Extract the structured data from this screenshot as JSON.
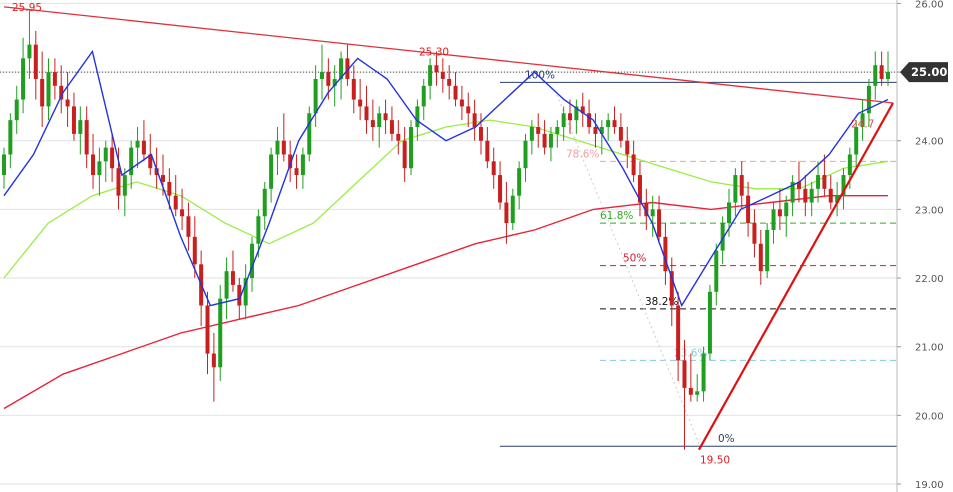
{
  "chart_data": {
    "type": "candlestick",
    "y_axis": {
      "ticks": [
        26.0,
        25.0,
        24.0,
        23.0,
        22.0,
        21.0,
        20.0,
        19.0
      ],
      "tick_labels": [
        "26.00",
        "25.00",
        "24.00",
        "23.00",
        "22.00",
        "21.00",
        "20.00",
        "19.00"
      ],
      "ylim": [
        19.0,
        26.05
      ],
      "position": "right"
    },
    "grid": true,
    "colors": {
      "up": "#1f9e1f",
      "down": "#c81f1f",
      "ma_fast": "#2233dd",
      "ma_mid": "#99ee44",
      "ma_slow": "#e8223a",
      "trendline": "#e0303a",
      "support_line": "#dd1111",
      "price_tag": "#333333"
    },
    "current_price": {
      "value": 25.0,
      "label": "25.00"
    },
    "annotations": {
      "high_label": {
        "text": "25.95",
        "price": 25.95
      },
      "swing_high_label": {
        "text": "25.30",
        "price": 25.3
      },
      "swing_low_label": {
        "text": "19.50",
        "price": 19.5
      },
      "fib_level_24_7": {
        "text": "24.7",
        "price": 24.25
      }
    },
    "fibonacci": {
      "high": 24.85,
      "low": 19.55,
      "levels": [
        {
          "label": "100%",
          "price": 24.85,
          "color": "#2a3f6e"
        },
        {
          "label": "78.6%",
          "price": 23.7,
          "color": "#f0a0a0"
        },
        {
          "label": "61.8%",
          "price": 22.8,
          "color": "#33aa22"
        },
        {
          "label": "50%",
          "price": 22.18,
          "color": "#cc2233"
        },
        {
          "label": "38.2%",
          "price": 21.55,
          "color": "#111111"
        },
        {
          "label": "23.6%",
          "price": 20.8,
          "color": "#88ccdd"
        },
        {
          "label": "0%",
          "price": 19.55,
          "color": "#2a3f6e"
        }
      ]
    },
    "candles": [
      [
        23.5,
        23.9,
        23.3,
        23.8
      ],
      [
        23.8,
        24.4,
        23.6,
        24.3
      ],
      [
        24.3,
        24.8,
        24.1,
        24.6
      ],
      [
        24.6,
        25.5,
        24.4,
        25.2
      ],
      [
        25.2,
        25.9,
        24.9,
        25.4
      ],
      [
        25.4,
        25.6,
        24.6,
        24.9
      ],
      [
        24.9,
        25.3,
        24.2,
        24.5
      ],
      [
        24.5,
        25.2,
        24.3,
        25.0
      ],
      [
        25.0,
        25.2,
        24.6,
        24.8
      ],
      [
        24.8,
        25.1,
        24.4,
        24.6
      ],
      [
        24.6,
        25.0,
        24.2,
        24.5
      ],
      [
        24.5,
        24.7,
        24.0,
        24.1
      ],
      [
        24.1,
        24.5,
        23.8,
        24.3
      ],
      [
        24.3,
        24.5,
        23.6,
        23.8
      ],
      [
        23.8,
        24.1,
        23.3,
        23.5
      ],
      [
        23.5,
        23.9,
        23.2,
        23.7
      ],
      [
        23.7,
        24.0,
        23.4,
        23.9
      ],
      [
        23.9,
        24.1,
        23.4,
        23.6
      ],
      [
        23.6,
        23.9,
        23.0,
        23.2
      ],
      [
        23.2,
        23.6,
        22.9,
        23.5
      ],
      [
        23.5,
        24.0,
        23.3,
        23.9
      ],
      [
        23.9,
        24.2,
        23.6,
        24.0
      ],
      [
        24.0,
        24.3,
        23.7,
        23.8
      ],
      [
        23.8,
        24.1,
        23.5,
        23.6
      ],
      [
        23.6,
        23.9,
        23.3,
        23.5
      ],
      [
        23.5,
        23.8,
        23.2,
        23.4
      ],
      [
        23.4,
        23.6,
        23.0,
        23.2
      ],
      [
        23.2,
        23.5,
        22.9,
        23.0
      ],
      [
        23.0,
        23.3,
        22.7,
        22.9
      ],
      [
        22.9,
        23.1,
        22.4,
        22.6
      ],
      [
        22.6,
        22.9,
        22.0,
        22.2
      ],
      [
        22.2,
        22.4,
        21.3,
        21.6
      ],
      [
        21.6,
        21.8,
        20.6,
        20.9
      ],
      [
        20.9,
        21.2,
        20.2,
        20.7
      ],
      [
        20.7,
        21.9,
        20.5,
        21.7
      ],
      [
        21.7,
        22.3,
        21.4,
        22.1
      ],
      [
        22.1,
        22.4,
        21.8,
        21.9
      ],
      [
        21.9,
        22.0,
        21.4,
        21.6
      ],
      [
        21.6,
        22.2,
        21.4,
        22.0
      ],
      [
        22.0,
        22.6,
        21.8,
        22.5
      ],
      [
        22.5,
        23.0,
        22.3,
        22.9
      ],
      [
        22.9,
        23.4,
        22.7,
        23.3
      ],
      [
        23.3,
        23.9,
        23.1,
        23.8
      ],
      [
        23.8,
        24.2,
        23.5,
        24.0
      ],
      [
        24.0,
        24.4,
        23.7,
        23.8
      ],
      [
        23.8,
        24.0,
        23.4,
        23.6
      ],
      [
        23.6,
        23.8,
        23.3,
        23.5
      ],
      [
        23.5,
        23.9,
        23.3,
        23.8
      ],
      [
        23.8,
        24.5,
        23.7,
        24.4
      ],
      [
        24.4,
        25.1,
        24.2,
        24.9
      ],
      [
        24.9,
        25.4,
        24.6,
        25.0
      ],
      [
        25.0,
        25.2,
        24.6,
        24.8
      ],
      [
        24.8,
        25.1,
        24.5,
        24.9
      ],
      [
        24.9,
        25.3,
        24.6,
        25.2
      ],
      [
        25.2,
        25.4,
        24.8,
        24.9
      ],
      [
        24.9,
        25.1,
        24.4,
        24.6
      ],
      [
        24.6,
        24.9,
        24.3,
        24.5
      ],
      [
        24.5,
        24.8,
        24.1,
        24.3
      ],
      [
        24.3,
        24.6,
        24.0,
        24.2
      ],
      [
        24.2,
        24.5,
        23.9,
        24.4
      ],
      [
        24.4,
        24.6,
        24.1,
        24.3
      ],
      [
        24.3,
        24.5,
        24.0,
        24.1
      ],
      [
        24.1,
        24.3,
        23.8,
        24.0
      ],
      [
        24.0,
        24.2,
        23.4,
        23.6
      ],
      [
        23.6,
        24.3,
        23.5,
        24.2
      ],
      [
        24.2,
        24.6,
        24.0,
        24.5
      ],
      [
        24.5,
        24.9,
        24.3,
        24.8
      ],
      [
        24.8,
        25.2,
        24.6,
        25.1
      ],
      [
        25.1,
        25.3,
        24.8,
        25.0
      ],
      [
        25.0,
        25.2,
        24.7,
        24.9
      ],
      [
        24.9,
        25.1,
        24.6,
        24.8
      ],
      [
        24.8,
        25.0,
        24.5,
        24.6
      ],
      [
        24.6,
        24.8,
        24.3,
        24.5
      ],
      [
        24.5,
        24.7,
        24.2,
        24.4
      ],
      [
        24.4,
        24.6,
        24.0,
        24.2
      ],
      [
        24.2,
        24.4,
        23.8,
        24.0
      ],
      [
        24.0,
        24.2,
        23.6,
        23.7
      ],
      [
        23.7,
        23.9,
        23.3,
        23.5
      ],
      [
        23.5,
        23.7,
        23.0,
        23.1
      ],
      [
        23.1,
        23.4,
        22.5,
        22.8
      ],
      [
        22.8,
        23.3,
        22.7,
        23.2
      ],
      [
        23.2,
        23.7,
        23.0,
        23.6
      ],
      [
        23.6,
        24.1,
        23.4,
        24.0
      ],
      [
        24.0,
        24.3,
        23.8,
        24.2
      ],
      [
        24.2,
        24.4,
        23.9,
        24.1
      ],
      [
        24.1,
        24.3,
        23.8,
        23.9
      ],
      [
        23.9,
        24.2,
        23.7,
        24.1
      ],
      [
        24.1,
        24.3,
        23.9,
        24.2
      ],
      [
        24.2,
        24.5,
        24.0,
        24.4
      ],
      [
        24.4,
        24.6,
        24.1,
        24.3
      ],
      [
        24.3,
        24.6,
        24.1,
        24.5
      ],
      [
        24.5,
        24.7,
        24.2,
        24.4
      ],
      [
        24.4,
        24.6,
        24.1,
        24.2
      ],
      [
        24.2,
        24.4,
        23.9,
        24.1
      ],
      [
        24.1,
        24.3,
        23.8,
        24.2
      ],
      [
        24.2,
        24.4,
        24.0,
        24.3
      ],
      [
        24.3,
        24.5,
        24.1,
        24.2
      ],
      [
        24.2,
        24.4,
        23.9,
        24.0
      ],
      [
        24.0,
        24.2,
        23.6,
        23.8
      ],
      [
        23.8,
        24.0,
        23.4,
        23.5
      ],
      [
        23.5,
        23.7,
        22.9,
        23.1
      ],
      [
        23.1,
        23.3,
        22.7,
        22.9
      ],
      [
        22.9,
        23.2,
        22.6,
        23.0
      ],
      [
        23.0,
        23.2,
        22.5,
        22.6
      ],
      [
        22.6,
        22.8,
        21.9,
        22.1
      ],
      [
        22.1,
        22.3,
        21.3,
        21.6
      ],
      [
        21.6,
        21.8,
        20.5,
        20.8
      ],
      [
        20.8,
        21.1,
        19.5,
        20.4
      ],
      [
        20.4,
        20.9,
        20.2,
        20.3
      ],
      [
        20.3,
        20.6,
        20.2,
        20.35
      ],
      [
        20.35,
        21.0,
        20.2,
        20.9
      ],
      [
        20.9,
        21.9,
        20.8,
        21.8
      ],
      [
        21.8,
        22.5,
        21.6,
        22.4
      ],
      [
        22.4,
        22.9,
        22.2,
        22.8
      ],
      [
        22.8,
        23.3,
        22.6,
        23.1
      ],
      [
        23.1,
        23.6,
        22.9,
        23.5
      ],
      [
        23.5,
        23.7,
        23.0,
        23.2
      ],
      [
        23.2,
        23.4,
        22.6,
        22.8
      ],
      [
        22.8,
        23.0,
        22.3,
        22.5
      ],
      [
        22.5,
        22.7,
        21.9,
        22.1
      ],
      [
        22.1,
        22.8,
        22.0,
        22.7
      ],
      [
        22.7,
        23.1,
        22.5,
        23.0
      ],
      [
        23.0,
        23.3,
        22.7,
        22.9
      ],
      [
        22.9,
        23.2,
        22.6,
        23.1
      ],
      [
        23.1,
        23.5,
        22.9,
        23.4
      ],
      [
        23.4,
        23.7,
        23.1,
        23.3
      ],
      [
        23.3,
        23.5,
        22.9,
        23.1
      ],
      [
        23.1,
        23.4,
        22.9,
        23.3
      ],
      [
        23.3,
        23.7,
        23.1,
        23.5
      ],
      [
        23.5,
        23.8,
        23.2,
        23.3
      ],
      [
        23.3,
        23.5,
        23.0,
        23.1
      ],
      [
        23.1,
        23.4,
        22.9,
        23.2
      ],
      [
        23.2,
        23.6,
        23.0,
        23.5
      ],
      [
        23.5,
        23.9,
        23.3,
        23.8
      ],
      [
        23.8,
        24.3,
        23.6,
        24.2
      ],
      [
        24.2,
        24.6,
        24.0,
        24.4
      ],
      [
        24.4,
        24.9,
        24.2,
        24.8
      ],
      [
        24.8,
        25.3,
        24.6,
        25.1
      ],
      [
        25.1,
        25.3,
        24.8,
        24.9
      ],
      [
        24.9,
        25.3,
        24.8,
        25.0
      ]
    ],
    "moving_averages": {
      "ma_fast": [
        [
          23.2,
          24.0
        ],
        [
          23.8,
          24.7
        ],
        [
          24.7,
          24.6
        ],
        [
          25.3,
          24.3
        ],
        [
          23.5,
          23.6
        ],
        [
          23.8,
          23.4
        ],
        [
          22.6,
          22.3
        ],
        [
          21.6,
          21.7
        ],
        [
          21.7,
          22.1
        ],
        [
          22.8,
          22.9
        ],
        [
          24.0,
          23.9
        ],
        [
          24.7,
          24.8
        ],
        [
          25.2,
          25.1
        ],
        [
          24.9,
          24.7
        ],
        [
          24.3,
          24.3
        ],
        [
          24.0,
          24.0
        ],
        [
          24.2,
          23.7
        ],
        [
          24.6,
          24.1
        ],
        [
          25.0,
          24.9
        ],
        [
          24.6,
          24.6
        ],
        [
          24.3,
          24.3
        ],
        [
          23.6,
          23.7
        ],
        [
          22.8,
          22.5
        ],
        [
          21.6,
          21.6
        ],
        [
          22.3,
          21.9
        ],
        [
          23.0,
          22.7
        ],
        [
          23.2,
          23.0
        ],
        [
          23.4,
          23.3
        ],
        [
          23.8,
          23.6
        ],
        [
          24.4,
          24.6
        ]
      ],
      "ma_mid": [
        [
          22.0,
          21.7
        ],
        [
          22.8,
          22.7
        ],
        [
          23.2,
          23.0
        ],
        [
          23.4,
          23.3
        ],
        [
          23.2,
          23.3
        ],
        [
          22.8,
          22.9
        ],
        [
          22.5,
          22.7
        ],
        [
          22.8,
          23.1
        ],
        [
          23.4,
          23.5
        ],
        [
          24.0,
          23.9
        ],
        [
          24.2,
          24.1
        ],
        [
          24.3,
          24.3
        ],
        [
          24.2,
          24.3
        ],
        [
          24.0,
          24.2
        ],
        [
          23.8,
          24.0
        ],
        [
          23.6,
          23.9
        ],
        [
          23.4,
          23.6
        ],
        [
          23.3,
          23.4
        ],
        [
          23.3,
          23.4
        ],
        [
          23.6,
          23.7
        ]
      ],
      "ma_slow": [
        [
          20.1,
          19.9
        ],
        [
          20.6,
          20.5
        ],
        [
          20.9,
          20.9
        ],
        [
          21.2,
          21.2
        ],
        [
          21.4,
          21.4
        ],
        [
          21.6,
          21.7
        ],
        [
          21.9,
          22.0
        ],
        [
          22.2,
          22.3
        ],
        [
          22.5,
          22.6
        ],
        [
          22.7,
          22.8
        ],
        [
          23.0,
          23.0
        ],
        [
          23.1,
          23.1
        ],
        [
          23.0,
          23.0
        ],
        [
          23.1,
          23.1
        ],
        [
          23.2,
          23.2
        ]
      ]
    },
    "trendlines": [
      {
        "name": "descending",
        "from_price": 25.95,
        "to_price": 24.55
      },
      {
        "name": "ascending",
        "from_price": 19.5,
        "to_price": 24.55
      }
    ]
  }
}
